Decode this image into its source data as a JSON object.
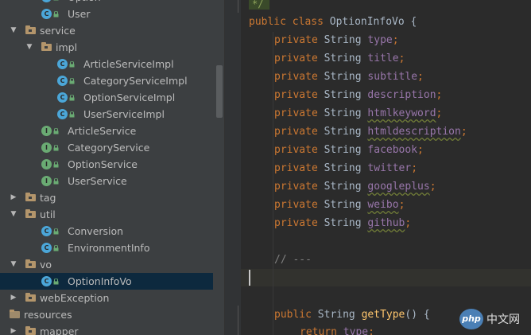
{
  "tree": {
    "rows": [
      {
        "label": "Option",
        "kind": "class",
        "icon": "class-icon",
        "letter": "C",
        "locked": true,
        "depth": 3,
        "arrow": ""
      },
      {
        "label": "User",
        "kind": "class",
        "icon": "class-icon",
        "letter": "C",
        "locked": true,
        "depth": 3,
        "arrow": ""
      },
      {
        "label": "service",
        "kind": "package",
        "icon": "package-folder-icon",
        "depth": 1,
        "arrow": "▼"
      },
      {
        "label": "impl",
        "kind": "package",
        "icon": "package-folder-icon",
        "depth": 2,
        "arrow": "▼"
      },
      {
        "label": "ArticleServiceImpl",
        "kind": "class",
        "icon": "class-icon",
        "letter": "C",
        "locked": true,
        "depth": 4,
        "arrow": ""
      },
      {
        "label": "CategoryServiceImpl",
        "kind": "class",
        "icon": "class-icon",
        "letter": "C",
        "locked": true,
        "depth": 4,
        "arrow": ""
      },
      {
        "label": "OptionServiceImpl",
        "kind": "class",
        "icon": "class-icon",
        "letter": "C",
        "locked": true,
        "depth": 4,
        "arrow": ""
      },
      {
        "label": "UserServiceImpl",
        "kind": "class",
        "icon": "class-icon",
        "letter": "C",
        "locked": true,
        "depth": 4,
        "arrow": ""
      },
      {
        "label": "ArticleService",
        "kind": "interface",
        "icon": "interface-icon",
        "letter": "I",
        "locked": true,
        "depth": 3,
        "arrow": ""
      },
      {
        "label": "CategoryService",
        "kind": "interface",
        "icon": "interface-icon",
        "letter": "I",
        "locked": true,
        "depth": 3,
        "arrow": ""
      },
      {
        "label": "OptionService",
        "kind": "interface",
        "icon": "interface-icon",
        "letter": "I",
        "locked": true,
        "depth": 3,
        "arrow": ""
      },
      {
        "label": "UserService",
        "kind": "interface",
        "icon": "interface-icon",
        "letter": "I",
        "locked": true,
        "depth": 3,
        "arrow": ""
      },
      {
        "label": "tag",
        "kind": "package",
        "icon": "package-folder-icon",
        "depth": 1,
        "arrow": "▶"
      },
      {
        "label": "util",
        "kind": "package",
        "icon": "package-folder-icon",
        "depth": 1,
        "arrow": "▼"
      },
      {
        "label": "Conversion",
        "kind": "class",
        "icon": "class-icon",
        "letter": "C",
        "locked": true,
        "depth": 3,
        "arrow": ""
      },
      {
        "label": "EnvironmentInfo",
        "kind": "class",
        "icon": "class-icon",
        "letter": "C",
        "locked": true,
        "depth": 3,
        "arrow": ""
      },
      {
        "label": "vo",
        "kind": "package",
        "icon": "package-folder-icon",
        "depth": 1,
        "arrow": "▼"
      },
      {
        "label": "OptionInfoVo",
        "kind": "class",
        "icon": "class-icon",
        "letter": "C",
        "locked": true,
        "depth": 3,
        "arrow": "",
        "selected": true
      },
      {
        "label": "webException",
        "kind": "package",
        "icon": "package-folder-icon",
        "depth": 1,
        "arrow": "▶"
      },
      {
        "label": "resources",
        "kind": "resources",
        "icon": "resources-folder-icon",
        "depth": 0,
        "arrow": ""
      },
      {
        "label": "mapper",
        "kind": "package",
        "icon": "package-folder-icon",
        "depth": 1,
        "arrow": "▶"
      }
    ]
  },
  "editor": {
    "doc_comment_end": "*/",
    "class_decl": {
      "modifier": "public",
      "keyword": "class",
      "name": "OptionInfoVo",
      "brace": "{"
    },
    "fields": [
      {
        "modifier": "private",
        "type": "String",
        "name": "type",
        "warn": false
      },
      {
        "modifier": "private",
        "type": "String",
        "name": "title",
        "warn": false
      },
      {
        "modifier": "private",
        "type": "String",
        "name": "subtitle",
        "warn": false
      },
      {
        "modifier": "private",
        "type": "String",
        "name": "description",
        "warn": false
      },
      {
        "modifier": "private",
        "type": "String",
        "name": "htmlkeyword",
        "warn": true
      },
      {
        "modifier": "private",
        "type": "String",
        "name": "htmldescription",
        "warn": true
      },
      {
        "modifier": "private",
        "type": "String",
        "name": "facebook",
        "warn": false
      },
      {
        "modifier": "private",
        "type": "String",
        "name": "twitter",
        "warn": false
      },
      {
        "modifier": "private",
        "type": "String",
        "name": "googleplus",
        "warn": true
      },
      {
        "modifier": "private",
        "type": "String",
        "name": "weibo",
        "warn": true
      },
      {
        "modifier": "private",
        "type": "String",
        "name": "github",
        "warn": true
      }
    ],
    "semicolon": ";",
    "comment": "// ---",
    "method": {
      "modifier": "public",
      "type": "String",
      "name": "getType",
      "parens": "()",
      "brace": "{"
    },
    "return_stmt": {
      "keyword": "return",
      "value": "type",
      "semicolon": ";"
    }
  },
  "watermark": {
    "logo": "php",
    "text": "中文网"
  },
  "colors": {
    "keyword": "#cc7832",
    "field": "#9876aa",
    "method": "#ffc66d",
    "comment": "#808080",
    "text": "#a9b7c6",
    "selection": "#0d293e"
  }
}
